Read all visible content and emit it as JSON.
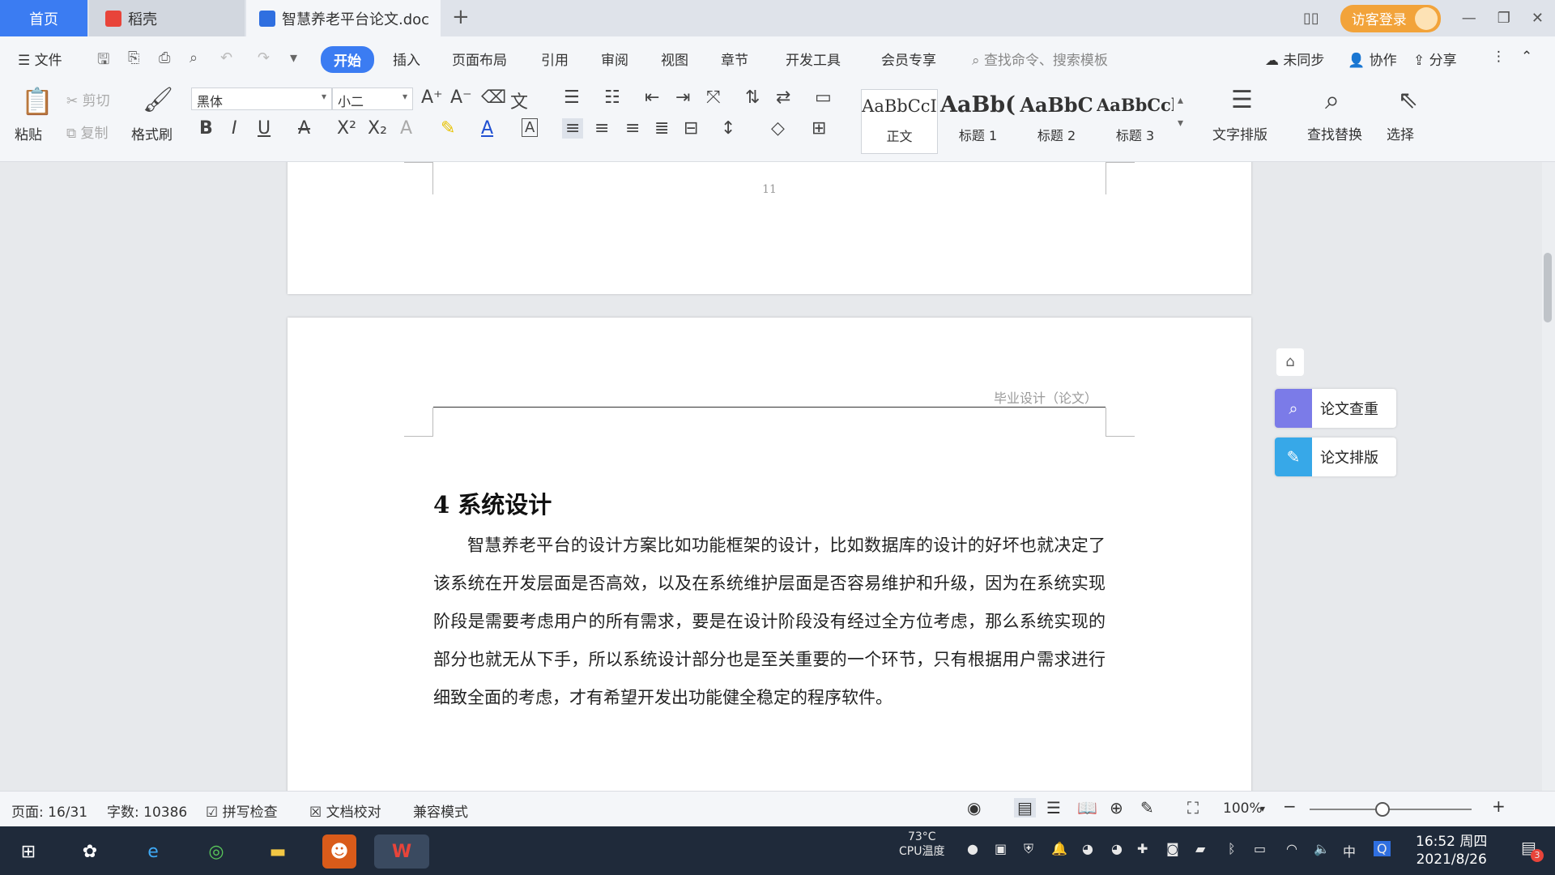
{
  "tabs": {
    "home": "首页",
    "daoke": "稻壳",
    "doc": "智慧养老平台论文.doc",
    "new_tab": "+"
  },
  "window": {
    "login": "访客登录"
  },
  "menu": {
    "file": "文件",
    "items": [
      "开始",
      "插入",
      "页面布局",
      "引用",
      "审阅",
      "视图",
      "章节",
      "开发工具",
      "会员专享"
    ],
    "search_placeholder": "查找命令、搜索模板",
    "sync": "未同步",
    "collab": "协作",
    "share": "分享"
  },
  "ribbon": {
    "paste": "粘贴",
    "cut": "剪切",
    "copy": "复制",
    "format_painter": "格式刷",
    "font_name": "黑体",
    "font_size": "小二",
    "styles": [
      {
        "preview": "AaBbCcI",
        "name": "正文"
      },
      {
        "preview": "AaBb(",
        "name": "标题 1"
      },
      {
        "preview": "AaBbC",
        "name": "标题 2"
      },
      {
        "preview": "AaBbCcl",
        "name": "标题 3"
      }
    ],
    "text_layout": "文字排版",
    "find_replace": "查找替换",
    "select": "选择"
  },
  "document": {
    "prev_page_number": "11",
    "header": "毕业设计（论文）",
    "heading": "4  系统设计",
    "paragraph": "智慧养老平台的设计方案比如功能框架的设计，比如数据库的设计的好坏也就决定了该系统在开发层面是否高效，以及在系统维护层面是否容易维护和升级，因为在系统实现阶段是需要考虑用户的所有需求，要是在设计阶段没有经过全方位考虑，那么系统实现的部分也就无从下手，所以系统设计部分也是至关重要的一个环节，只有根据用户需求进行细致全面的考虑，才有希望开发出功能健全稳定的程序软件。"
  },
  "side_panel": {
    "check": "论文查重",
    "format": "论文排版"
  },
  "status": {
    "page": "页面: 16/31",
    "words": "字数: 10386",
    "spell": "拼写检查",
    "proof": "文档校对",
    "compat": "兼容模式",
    "zoom": "100%",
    "zoom_level_fraction": 0.45
  },
  "taskbar": {
    "cpu_temp": "73°C",
    "cpu_label": "CPU温度",
    "ime": "中",
    "time": "16:52 周四",
    "date": "2021/8/26",
    "notif_count": "3"
  }
}
